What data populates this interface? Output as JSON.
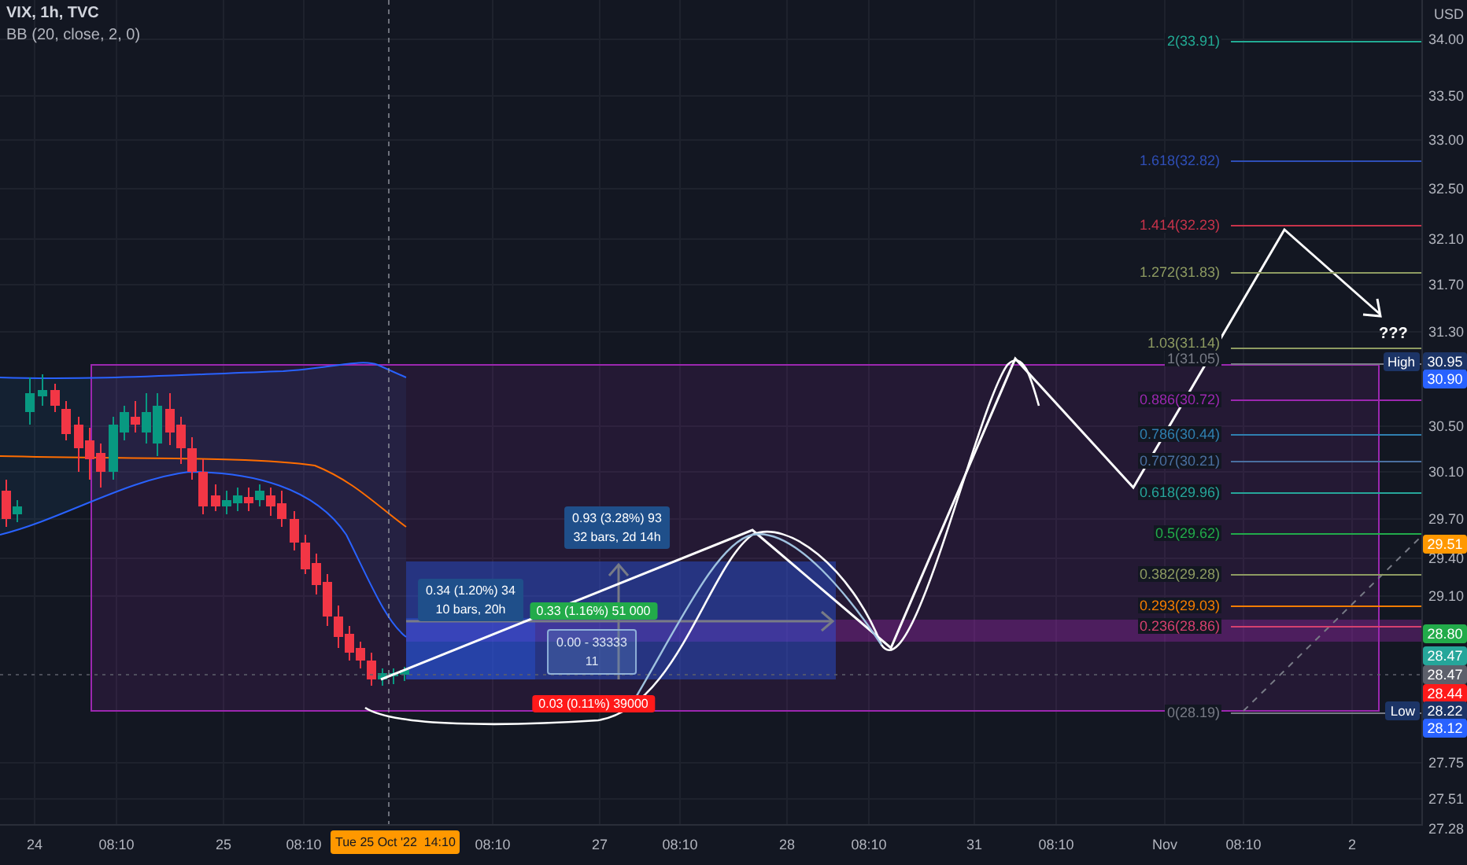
{
  "legend": {
    "symbol": "VIX, 1h, TVC",
    "indicator": "BB (20, close, 2, 0)"
  },
  "price_axis": {
    "currency": "USD",
    "ticks": [
      "34.00",
      "33.50",
      "33.00",
      "32.50",
      "32.10",
      "31.70",
      "31.30",
      "30.50",
      "30.10",
      "29.70",
      "29.40",
      "29.10",
      "27.75",
      "27.51",
      "27.28"
    ],
    "badges": [
      {
        "text": "30.95",
        "color": "#1c3466",
        "tag": "High"
      },
      {
        "text": "30.90",
        "color": "#2962ff"
      },
      {
        "text": "29.51",
        "color": "#ff9800"
      },
      {
        "text": "28.80",
        "color": "#22ab4a"
      },
      {
        "text": "28.47",
        "color": "#26a69a"
      },
      {
        "text": "28.47",
        "color": "#5d606b"
      },
      {
        "text": "28.44",
        "color": "#ff1a1a"
      },
      {
        "text": "28.22",
        "color": "#1c3466",
        "tag": "Low"
      },
      {
        "text": "28.12",
        "color": "#2962ff"
      }
    ]
  },
  "fib_levels": [
    {
      "label": "2(33.91)",
      "color": "#22ab94"
    },
    {
      "label": "1.618(32.82)",
      "color": "#2f4fb8"
    },
    {
      "label": "1.414(32.23)",
      "color": "#c8334a"
    },
    {
      "label": "1.272(31.83)",
      "color": "#8e9b62"
    },
    {
      "label": "1.03(31.14)",
      "color": "#8e9b62"
    },
    {
      "label": "1(31.05)",
      "color": "#787b86"
    },
    {
      "label": "0.886(30.72)",
      "color": "#9c27b0"
    },
    {
      "label": "0.786(30.44)",
      "color": "#2f7fb0"
    },
    {
      "label": "0.707(30.21)",
      "color": "#4a6fa0"
    },
    {
      "label": "0.618(29.96)",
      "color": "#26a69a"
    },
    {
      "label": "0.5(29.62)",
      "color": "#22ab4a"
    },
    {
      "label": "0.382(29.28)",
      "color": "#8e9b62"
    },
    {
      "label": "0.293(29.03)",
      "color": "#f57c00"
    },
    {
      "label": "0.236(28.86)",
      "color": "#d6406f"
    },
    {
      "label": "0(28.19)",
      "color": "#787b86"
    }
  ],
  "measurements": [
    {
      "kind": "info",
      "lines": [
        "0.93 (3.28%) 93",
        "32 bars, 2d 14h"
      ]
    },
    {
      "kind": "info",
      "lines": [
        "0.34 (1.20%) 34",
        "10 bars, 20h"
      ]
    },
    {
      "kind": "gain",
      "lines": [
        "0.33 (1.16%) 51 000"
      ]
    },
    {
      "kind": "outline",
      "lines": [
        "0.00 - 33333",
        "11"
      ]
    },
    {
      "kind": "loss",
      "lines": [
        "0.03 (0.11%) 39000"
      ]
    }
  ],
  "annotation": "???",
  "time_axis": {
    "labels": [
      "24",
      "08:10",
      "25",
      "08:10",
      "08:10",
      "27",
      "08:10",
      "28",
      "08:10",
      "31",
      "08:10",
      "Nov",
      "08:10",
      "2"
    ],
    "cursor_badge": "Tue 25 Oct '22  14:10"
  }
}
